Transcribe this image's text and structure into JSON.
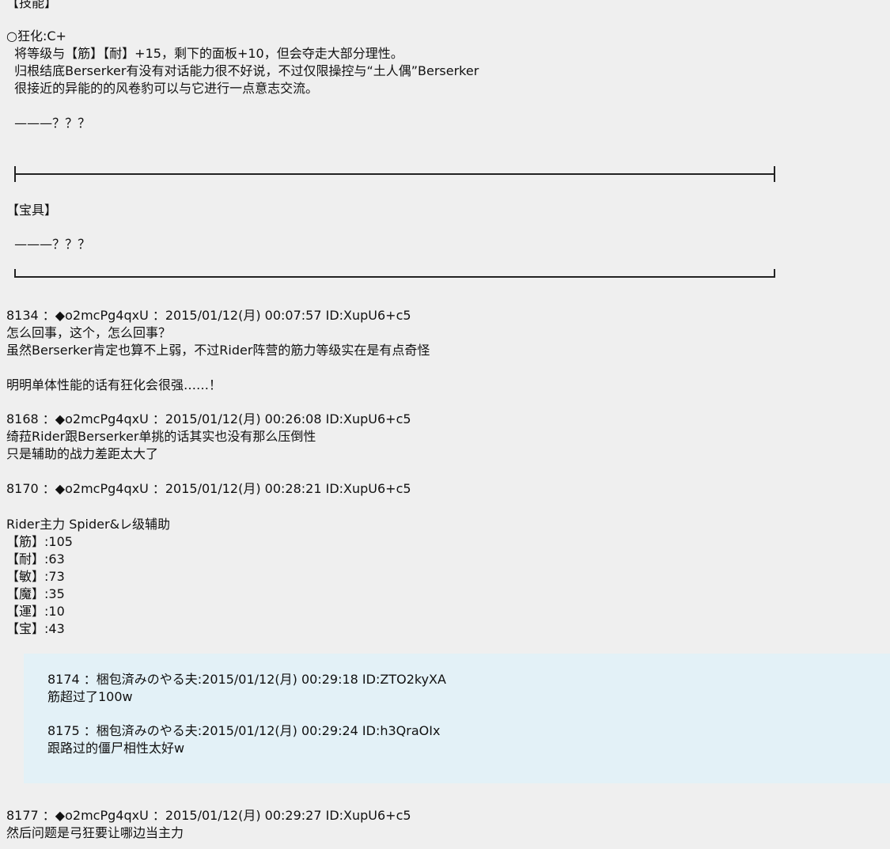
{
  "skills": {
    "header": "【技能】",
    "madness": "○狂化:C+",
    "desc_lines": [
      "  将等级与【筋】【耐】+15，剩下的面板+10，但会夺走大部分理性。",
      "  归根结底Berserker有没有对话能力很不好说，不过仅限操控与“土人偶”Berserker",
      "  很接近的异能的的风卷豹可以与它进行一点意志交流。"
    ],
    "unknown": "  ———？？？"
  },
  "noble_phantasm": {
    "header": "【宝具】",
    "unknown": "  ———？？？"
  },
  "posts": [
    {
      "header": "8134 ：◆o2mcPg4qxU ：2015/01/12(月) 00:07:57 ID:XupU6+c5",
      "lines": [
        "怎么回事，这个，怎么回事？",
        "虽然Berserker肯定也算不上弱，不过Rider阵营的筋力等级实在是有点奇怪",
        "",
        "明明单体性能的话有狂化会很强……！"
      ]
    },
    {
      "header": "8168 ：◆o2mcPg4qxU ：2015/01/12(月) 00:26:08 ID:XupU6+c5",
      "lines": [
        "绮菈Rider跟Berserker单挑的话其实也没有那么压倒性",
        "只是辅助的战力差距太大了"
      ]
    },
    {
      "header": "8170 ：◆o2mcPg4qxU ：2015/01/12(月) 00:28:21 ID:XupU6+c5",
      "lines": [
        "",
        "Rider主力 Spider&レ级辅助",
        "【筋】:105",
        "【耐】:63",
        "【敏】:73",
        "【魔】:35",
        "【運】:10",
        "【宝】:43"
      ]
    }
  ],
  "quotes": [
    {
      "header": "8174 ：梱包済みのやる夫:2015/01/12(月) 00:29:18 ID:ZTO2kyXA",
      "text": "筋超过了100w"
    },
    {
      "header": "8175 ：梱包済みのやる夫:2015/01/12(月) 00:29:24 ID:h3QraOIx",
      "text": "跟路过的僵尸相性太好w"
    }
  ],
  "last_post": {
    "header": "8177 ：◆o2mcPg4qxU ：2015/01/12(月) 00:29:27 ID:XupU6+c5",
    "text": "然后问题是弓狂要让哪边当主力"
  }
}
